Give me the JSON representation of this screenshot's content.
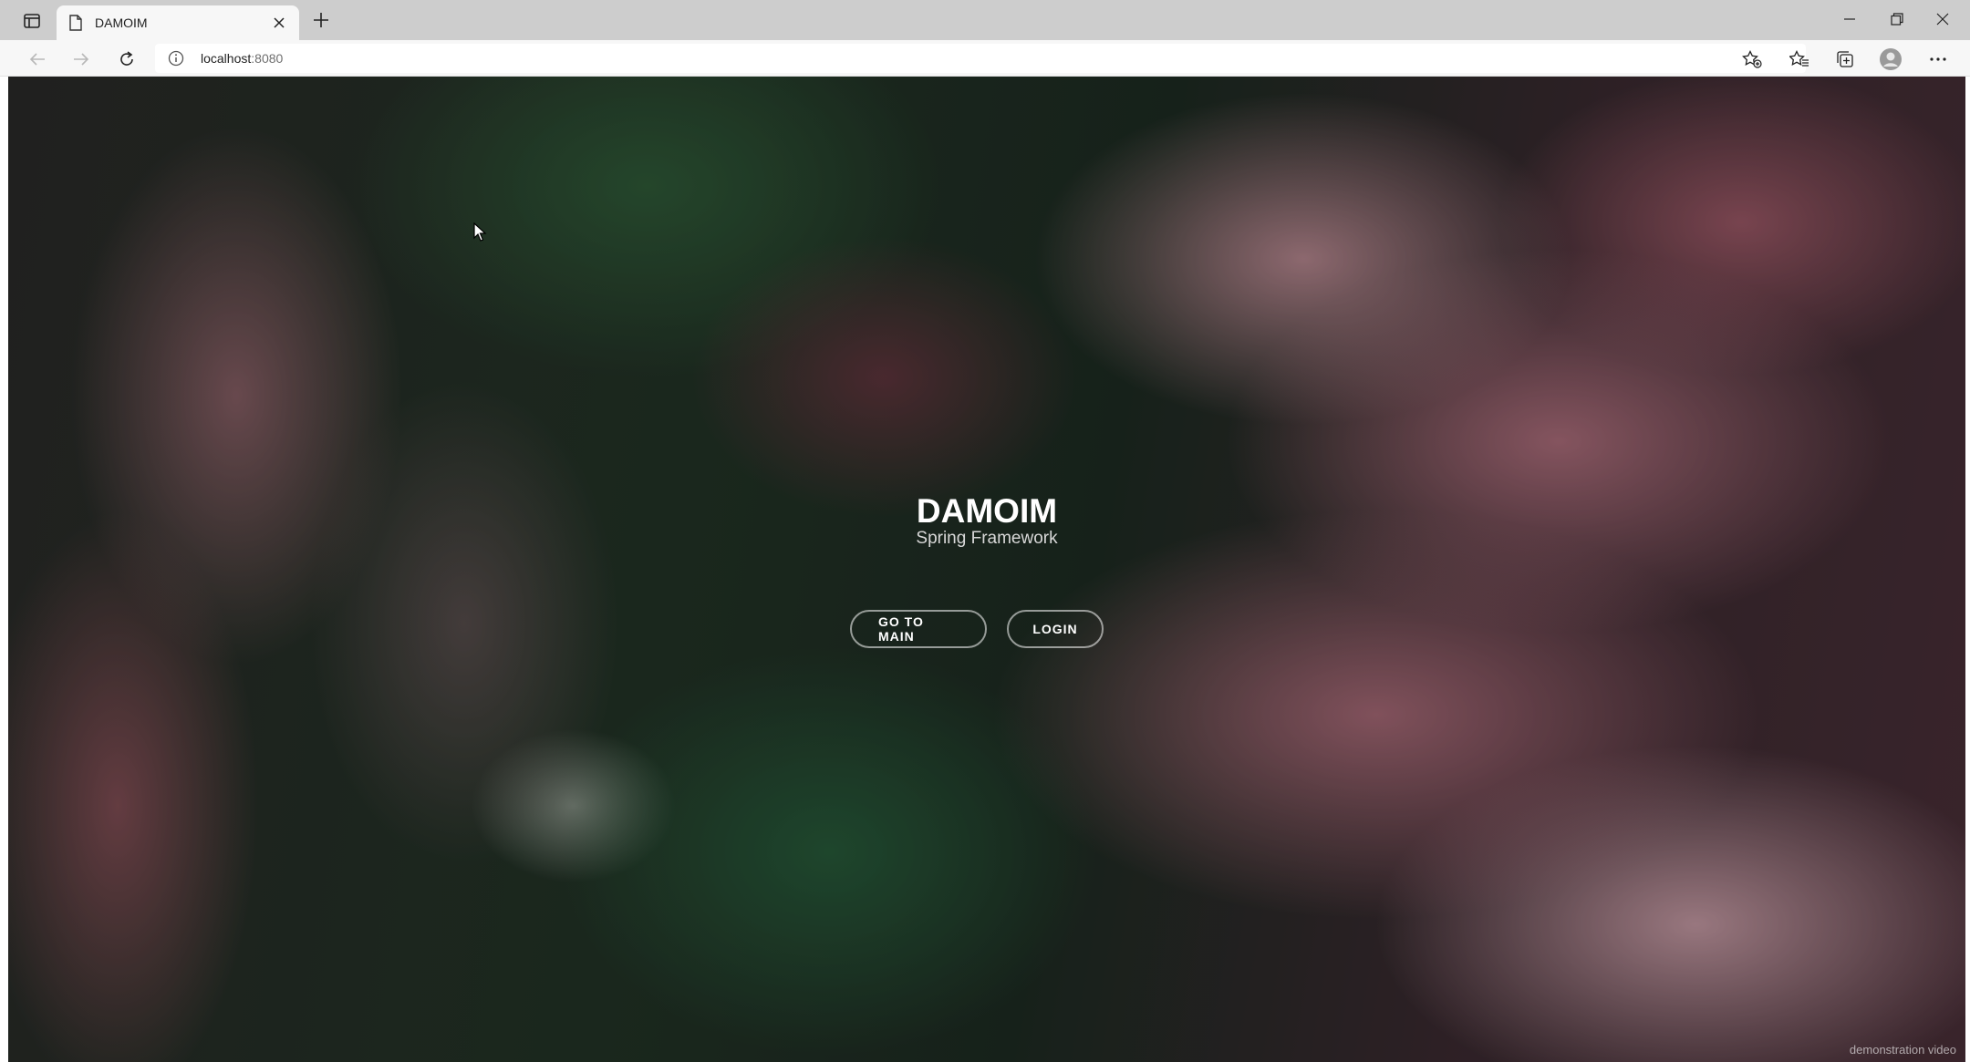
{
  "tab": {
    "title": "DAMOIM"
  },
  "address": {
    "host": "localhost",
    "port": ":8080"
  },
  "page": {
    "title": "DAMOIM",
    "subtitle": "Spring Framework",
    "buttons": {
      "main": "GO TO MAIN",
      "login": "LOGIN"
    },
    "caption": "demonstration video"
  },
  "colors": {
    "tabstrip": "#cdcdcd",
    "toolbar": "#f7f7f7",
    "button_border": "rgba(255,255,255,0.55)"
  }
}
